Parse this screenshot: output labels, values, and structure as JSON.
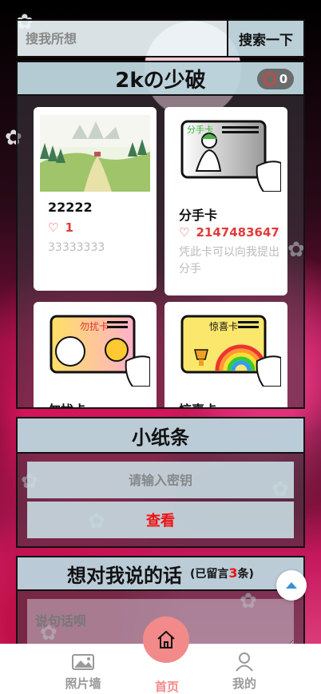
{
  "search": {
    "placeholder": "搜我所想",
    "button_label": "搜索一下"
  },
  "card_section": {
    "title": "2kの少破",
    "count": "0",
    "cards": [
      {
        "title": "22222",
        "count": "1",
        "description": "33333333",
        "image": "landscape-illustration"
      },
      {
        "title": "分手卡",
        "count": "2147483647",
        "description": "凭此卡可以向我提出分手",
        "image_label": "分手卡"
      },
      {
        "title": "勿扰卡",
        "image_label": "勿扰卡"
      },
      {
        "title": "惊喜卡",
        "image_label": "惊喜卡"
      }
    ]
  },
  "note_section": {
    "title": "小纸条",
    "password_placeholder": "请输入密钥",
    "view_label": "查看"
  },
  "message_section": {
    "title": "想对我说的话",
    "sub_prefix": "(已留言",
    "sub_count": "3",
    "sub_suffix": "条)",
    "input_placeholder": "说句话呗"
  },
  "nav": {
    "items": [
      {
        "label": "照片墙",
        "icon": "photo-icon"
      },
      {
        "label": "首页",
        "icon": "home-icon",
        "active": true
      },
      {
        "label": "我的",
        "icon": "user-icon"
      }
    ]
  },
  "colors": {
    "accent": "#e23b3b",
    "nav_active": "#f38a8a",
    "panel_head": "#c0d8e2"
  }
}
